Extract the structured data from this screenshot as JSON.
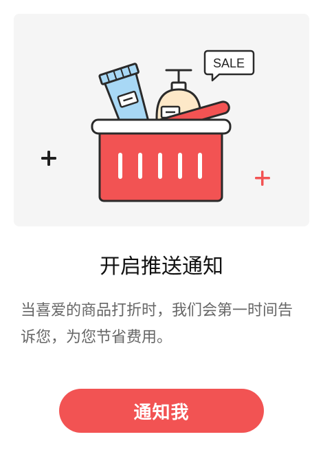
{
  "illustration": {
    "sale_tag": "SALE"
  },
  "title": "开启推送通知",
  "description": "当喜爱的商品打折时，我们会第一时间告诉您，为您节省费用。",
  "cta_label": "通知我",
  "colors": {
    "accent": "#f25353",
    "card_bg": "#f5f5f5",
    "title": "#111111",
    "body_text": "#666666"
  }
}
